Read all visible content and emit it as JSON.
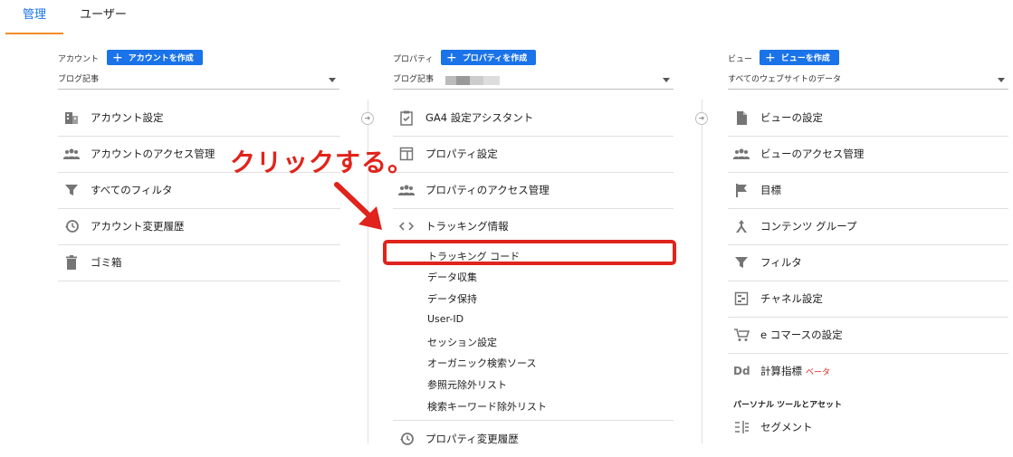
{
  "tabs": [
    {
      "label": "管理",
      "active": true
    },
    {
      "label": "ユーザー",
      "active": false
    }
  ],
  "columns": {
    "account": {
      "label": "アカウント",
      "create_button": "アカウントを作成",
      "selected": "ブログ記事",
      "items": [
        {
          "label": "アカウント設定",
          "icon": "building-icon"
        },
        {
          "label": "アカウントのアクセス管理",
          "icon": "people-icon"
        },
        {
          "label": "すべてのフィルタ",
          "icon": "filter-icon"
        },
        {
          "label": "アカウント変更履歴",
          "icon": "history-icon"
        },
        {
          "label": "ゴミ箱",
          "icon": "trash-icon"
        }
      ]
    },
    "property": {
      "label": "プロパティ",
      "create_button": "プロパティを作成",
      "selected": "ブログ記事",
      "items": [
        {
          "label": "GA4 設定アシスタント",
          "icon": "clipboard-check-icon"
        },
        {
          "label": "プロパティ設定",
          "icon": "property-layout-icon"
        },
        {
          "label": "プロパティのアクセス管理",
          "icon": "people-icon"
        },
        {
          "label": "トラッキング情報",
          "icon": "code-icon"
        }
      ],
      "tracking_subitems": [
        "トラッキング コード",
        "データ収集",
        "データ保持",
        "User-ID",
        "セッション設定",
        "オーガニック検索ソース",
        "参照元除外リスト",
        "検索キーワード除外リスト"
      ],
      "history_item": {
        "label": "プロパティ変更履歴",
        "icon": "history-icon"
      }
    },
    "view": {
      "label": "ビュー",
      "create_button": "ビューを作成",
      "selected": "すべてのウェブサイトのデータ",
      "items": [
        {
          "label": "ビューの設定",
          "icon": "document-icon"
        },
        {
          "label": "ビューのアクセス管理",
          "icon": "people-icon"
        },
        {
          "label": "目標",
          "icon": "flag-icon"
        },
        {
          "label": "コンテンツ グループ",
          "icon": "content-group-icon"
        },
        {
          "label": "フィルタ",
          "icon": "filter-icon"
        },
        {
          "label": "チャネル設定",
          "icon": "channel-icon"
        },
        {
          "label": "e コマースの設定",
          "icon": "cart-icon"
        },
        {
          "label": "計算指標",
          "icon": "dd-icon",
          "badge": "ベータ"
        }
      ],
      "section_title": "パーソナル ツールとアセット",
      "segment_item": {
        "label": "セグメント",
        "icon": "segment-icon"
      }
    }
  },
  "annotation": {
    "callout_text": "クリックする。",
    "color": "#e0231c"
  },
  "colors": {
    "accent": "#1a73e8",
    "tab_underline": "#f28c28"
  }
}
